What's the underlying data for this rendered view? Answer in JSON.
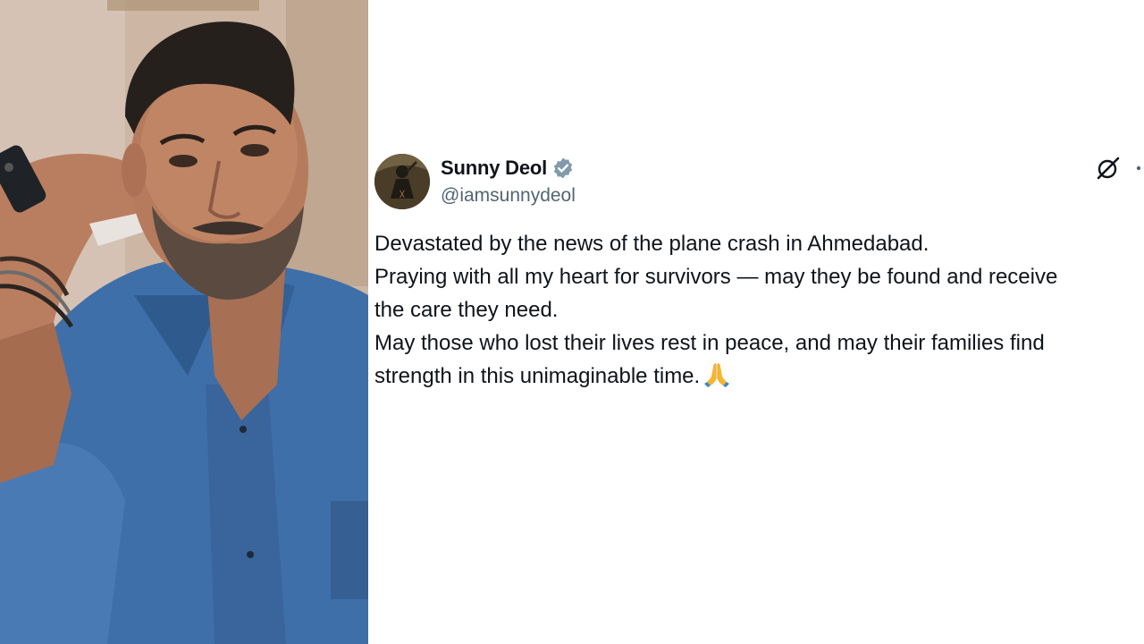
{
  "photo": {
    "alt_icon": "person-portrait"
  },
  "tweet": {
    "author": {
      "display_name": "Sunny Deol",
      "handle": "@iamsunnydeol",
      "verified": true,
      "verified_color": "#829aab"
    },
    "icons": {
      "grok": "grok-icon",
      "more": "more-options-icon"
    },
    "lines": [
      "Devastated by the news of the plane crash in Ahmedabad.",
      "Praying with all my heart for survivors — may they be found and receive",
      "the care they need.",
      "May those who lost their lives rest in peace, and may their families find",
      "strength in this unimaginable time."
    ],
    "emoji": "🙏"
  },
  "colors": {
    "text_primary": "#0f1419",
    "text_secondary": "#536471",
    "shirt_blue": "#3f6fa8"
  }
}
